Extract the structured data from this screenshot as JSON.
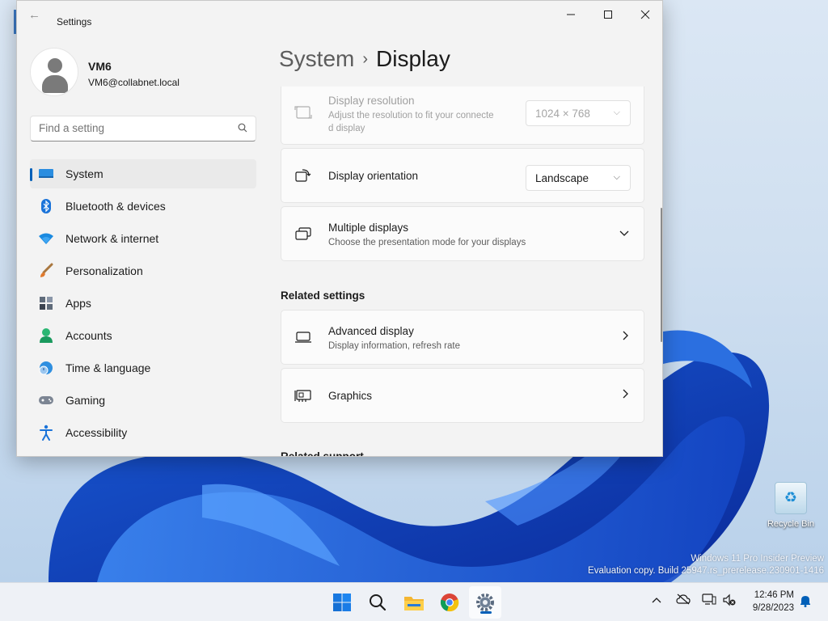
{
  "window": {
    "app_title": "Settings",
    "back_icon": "back-arrow-icon",
    "controls": [
      "minimize",
      "maximize",
      "close"
    ]
  },
  "profile": {
    "name": "VM6",
    "email": "VM6@collabnet.local"
  },
  "search": {
    "placeholder": "Find a setting"
  },
  "sidebar": {
    "items": [
      {
        "label": "System",
        "icon": "system-monitor-icon",
        "active": true
      },
      {
        "label": "Bluetooth & devices",
        "icon": "bluetooth-icon"
      },
      {
        "label": "Network & internet",
        "icon": "wifi-icon"
      },
      {
        "label": "Personalization",
        "icon": "paintbrush-icon"
      },
      {
        "label": "Apps",
        "icon": "apps-icon"
      },
      {
        "label": "Accounts",
        "icon": "person-icon"
      },
      {
        "label": "Time & language",
        "icon": "globe-clock-icon"
      },
      {
        "label": "Gaming",
        "icon": "controller-icon"
      },
      {
        "label": "Accessibility",
        "icon": "accessibility-icon"
      }
    ]
  },
  "header": {
    "breadcrumb": "System",
    "separator": "›",
    "current": "Display"
  },
  "cards": {
    "resolution": {
      "title": "Display resolution",
      "subtitle_line1": "Adjust the resolution to fit your connecte",
      "subtitle_line2": "d display",
      "value": "1024 × 768",
      "disabled": true
    },
    "orientation": {
      "title": "Display orientation",
      "value": "Landscape"
    },
    "multiple": {
      "title": "Multiple displays",
      "subtitle": "Choose the presentation mode for your displays"
    },
    "related_heading": "Related settings",
    "advanced": {
      "title": "Advanced display",
      "subtitle": "Display information, refresh rate"
    },
    "graphics": {
      "title": "Graphics"
    },
    "support_heading": "Related support"
  },
  "desktop": {
    "recycle_bin_label": "Recycle Bin",
    "watermark_line1": "Windows 11 Pro Insider Preview",
    "watermark_line2": "Evaluation copy. Build 25947.rs_prerelease.230901-1416"
  },
  "taskbar": {
    "apps": [
      "start-icon",
      "search-icon",
      "file-explorer-icon",
      "chrome-icon",
      "settings-gear-icon"
    ],
    "time": "12:46 PM",
    "date": "9/28/2023",
    "accent": "#005fb8"
  }
}
